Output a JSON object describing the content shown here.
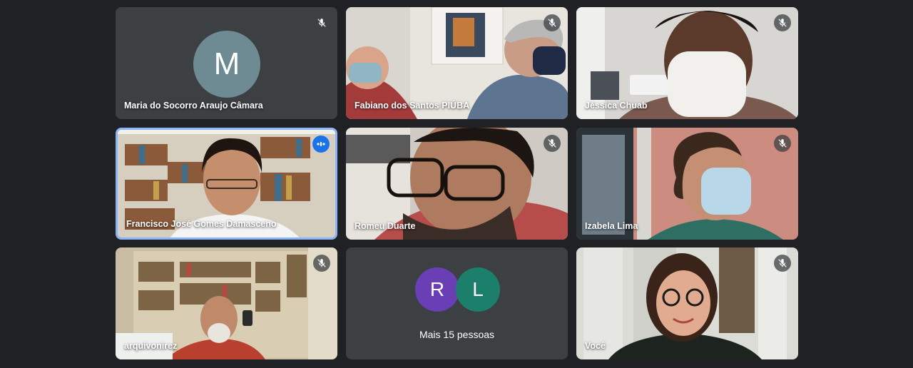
{
  "colors": {
    "background": "#202124",
    "tile": "#3c4043",
    "speaking_border": "#8ab4f8",
    "avatar_m": "#6e8a93",
    "avatar_r": "#6a3fb5",
    "avatar_l": "#1b7f6c"
  },
  "participants": [
    {
      "name": "Maria do Socorro Araujo Câmara",
      "initial": "M",
      "muted": true,
      "icon": "mic-off-icon"
    },
    {
      "name": "Fabiano dos Santos PIÚBA",
      "muted": true,
      "icon": "mic-off-icon"
    },
    {
      "name": "Jéssica Chuab",
      "muted": true,
      "icon": "mic-off-icon"
    },
    {
      "name": "Francisco José Gomes Damasceno",
      "muted": false,
      "speaking": true,
      "icon": "audio-level-icon"
    },
    {
      "name": "Romeu Duarte",
      "muted": true,
      "icon": "mic-off-icon"
    },
    {
      "name": "Izabela Lima",
      "muted": true,
      "icon": "mic-off-icon"
    },
    {
      "name": "arquivonirez",
      "muted": true,
      "icon": "mic-off-icon"
    },
    {
      "name": "Você",
      "muted": true,
      "icon": "mic-off-icon"
    }
  ],
  "more_people": {
    "label": "Mais 15 pessoas",
    "initials": [
      "R",
      "L"
    ]
  }
}
